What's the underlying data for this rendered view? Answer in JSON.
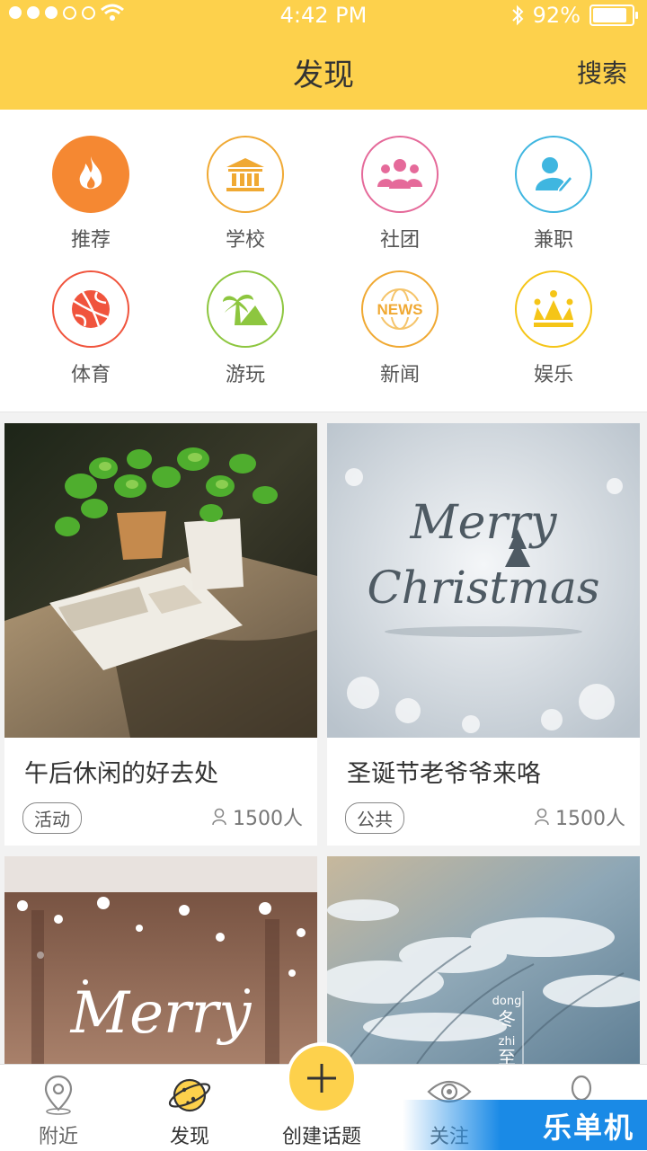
{
  "status_bar": {
    "time": "4:42 PM",
    "battery": "92%",
    "battery_level": 0.92
  },
  "header": {
    "title": "发现",
    "search_label": "搜索"
  },
  "categories": [
    {
      "label": "推荐",
      "icon": "fire-icon",
      "color": "#f58832"
    },
    {
      "label": "学校",
      "icon": "school-building-icon",
      "color": "#f0a933"
    },
    {
      "label": "社团",
      "icon": "club-people-icon",
      "color": "#e56a9a"
    },
    {
      "label": "兼职",
      "icon": "part-time-job-icon",
      "color": "#3fb6e0"
    },
    {
      "label": "体育",
      "icon": "basketball-icon",
      "color": "#f0543d"
    },
    {
      "label": "游玩",
      "icon": "palm-tree-icon",
      "color": "#8dc63f"
    },
    {
      "label": "新闻",
      "icon": "news-globe-icon",
      "color": "#f0a933"
    },
    {
      "label": "娱乐",
      "icon": "crown-icon",
      "color": "#f5c518"
    }
  ],
  "cards": [
    {
      "title": "午后休闲的好去处",
      "tag": "活动",
      "count": "1500人"
    },
    {
      "title": "圣诞节老爷爷来咯",
      "tag": "公共",
      "count": "1500人"
    },
    {
      "title": "",
      "tag": "",
      "count": ""
    },
    {
      "title": "",
      "tag": "",
      "count": ""
    }
  ],
  "image_text": {
    "merry_christmas_line1": "Merry",
    "merry_christmas_line2": "Christmas",
    "merry": "Merry",
    "dong": "dong",
    "dong_char": "冬",
    "zhi": "zhi",
    "zhi_char": "至"
  },
  "tabbar": {
    "nearby": "附近",
    "discover": "发现",
    "create": "创建话题",
    "follow": "关注"
  },
  "watermark": "乐单机",
  "colors": {
    "accent": "#fdd14c"
  }
}
